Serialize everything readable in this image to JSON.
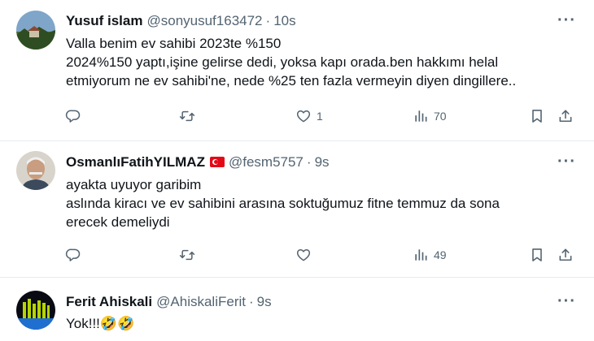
{
  "tweets": [
    {
      "display_name": "Yusuf islam",
      "handle": "@sonyusuf163472",
      "separator": "·",
      "time": "10s",
      "more": "···",
      "lines": [
        "Valla benim ev sahibi 2023te %150",
        "2024%150 yaptı,işine gelirse dedi, yoksa kapı orada.ben hakkımı helal",
        "etmiyorum ne ev sahibi'ne, nede %25 ten fazla vermeyin diyen dingillere.."
      ],
      "likes": "1",
      "views": "70"
    },
    {
      "display_name": "OsmanlıFatihYILMAZ",
      "handle": "@fesm5757",
      "separator": "·",
      "time": "9s",
      "more": "···",
      "lines": [
        "ayakta uyuyor garibim",
        "aslında kiracı ve ev sahibini arasına soktuğumuz fitne temmuz da sona",
        "erecek demeliydi"
      ],
      "likes": "",
      "views": "49"
    },
    {
      "display_name": "Ferit Ahiskali",
      "handle": "@AhiskaliFerit",
      "separator": "·",
      "time": "9s",
      "more": "···",
      "lines": [
        "Yok!!!🤣🤣"
      ]
    }
  ],
  "colors": {
    "text": "#0f1419",
    "muted": "#536471",
    "divider": "#e6ecf0",
    "flag": "#e30a17"
  },
  "icons": [
    "reply-icon",
    "retweet-icon",
    "like-icon",
    "views-icon",
    "bookmark-icon",
    "share-icon",
    "turkey-flag-icon"
  ]
}
